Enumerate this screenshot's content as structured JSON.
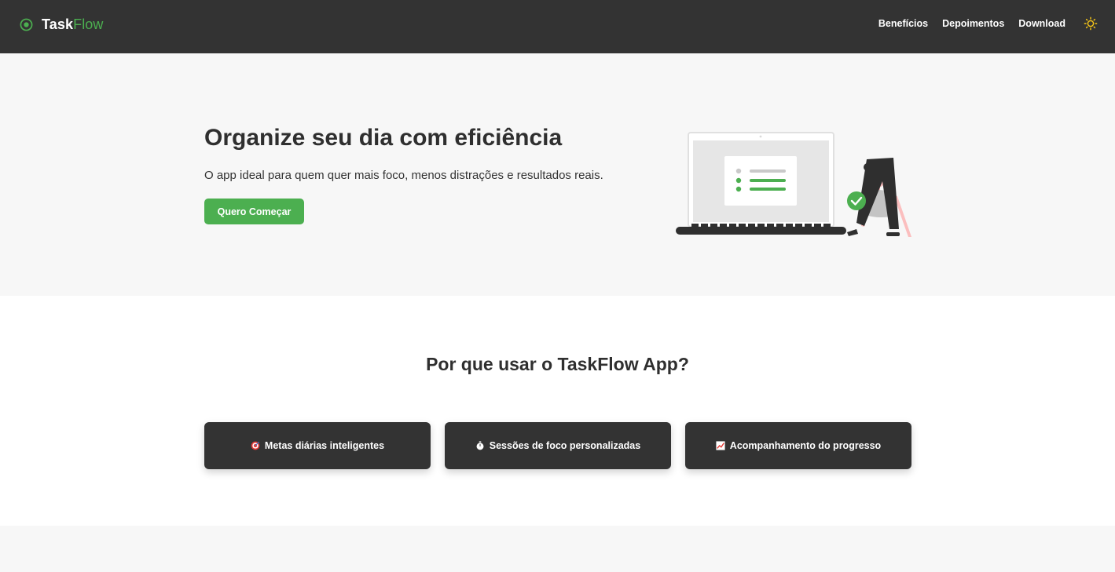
{
  "nav": {
    "brand_part1": "Task",
    "brand_part2": "Flow",
    "brand_icon": "target-icon",
    "links": [
      "Benefícios",
      "Depoimentos",
      "Download"
    ],
    "theme_icon": "sun-icon"
  },
  "hero": {
    "title": "Organize seu dia com eficiência",
    "subtitle": "O app ideal para quem quer mais foco, menos distrações e resultados reais.",
    "cta_label": "Quero Começar",
    "illustration": "woman-with-laptop-task-list-illustration"
  },
  "features": {
    "title": "Por que usar o TaskFlow App?",
    "cards": [
      {
        "icon": "target-icon",
        "label": "Metas diárias inteligentes"
      },
      {
        "icon": "stopwatch-icon",
        "label": "Sessões de foco personalizadas"
      },
      {
        "icon": "chart-increasing-icon",
        "label": "Acompanhamento do progresso"
      }
    ]
  },
  "colors": {
    "accent": "#4caf50",
    "navbar_bg": "#333333",
    "hero_bg": "#f7f7f7",
    "card_bg": "#333333"
  }
}
